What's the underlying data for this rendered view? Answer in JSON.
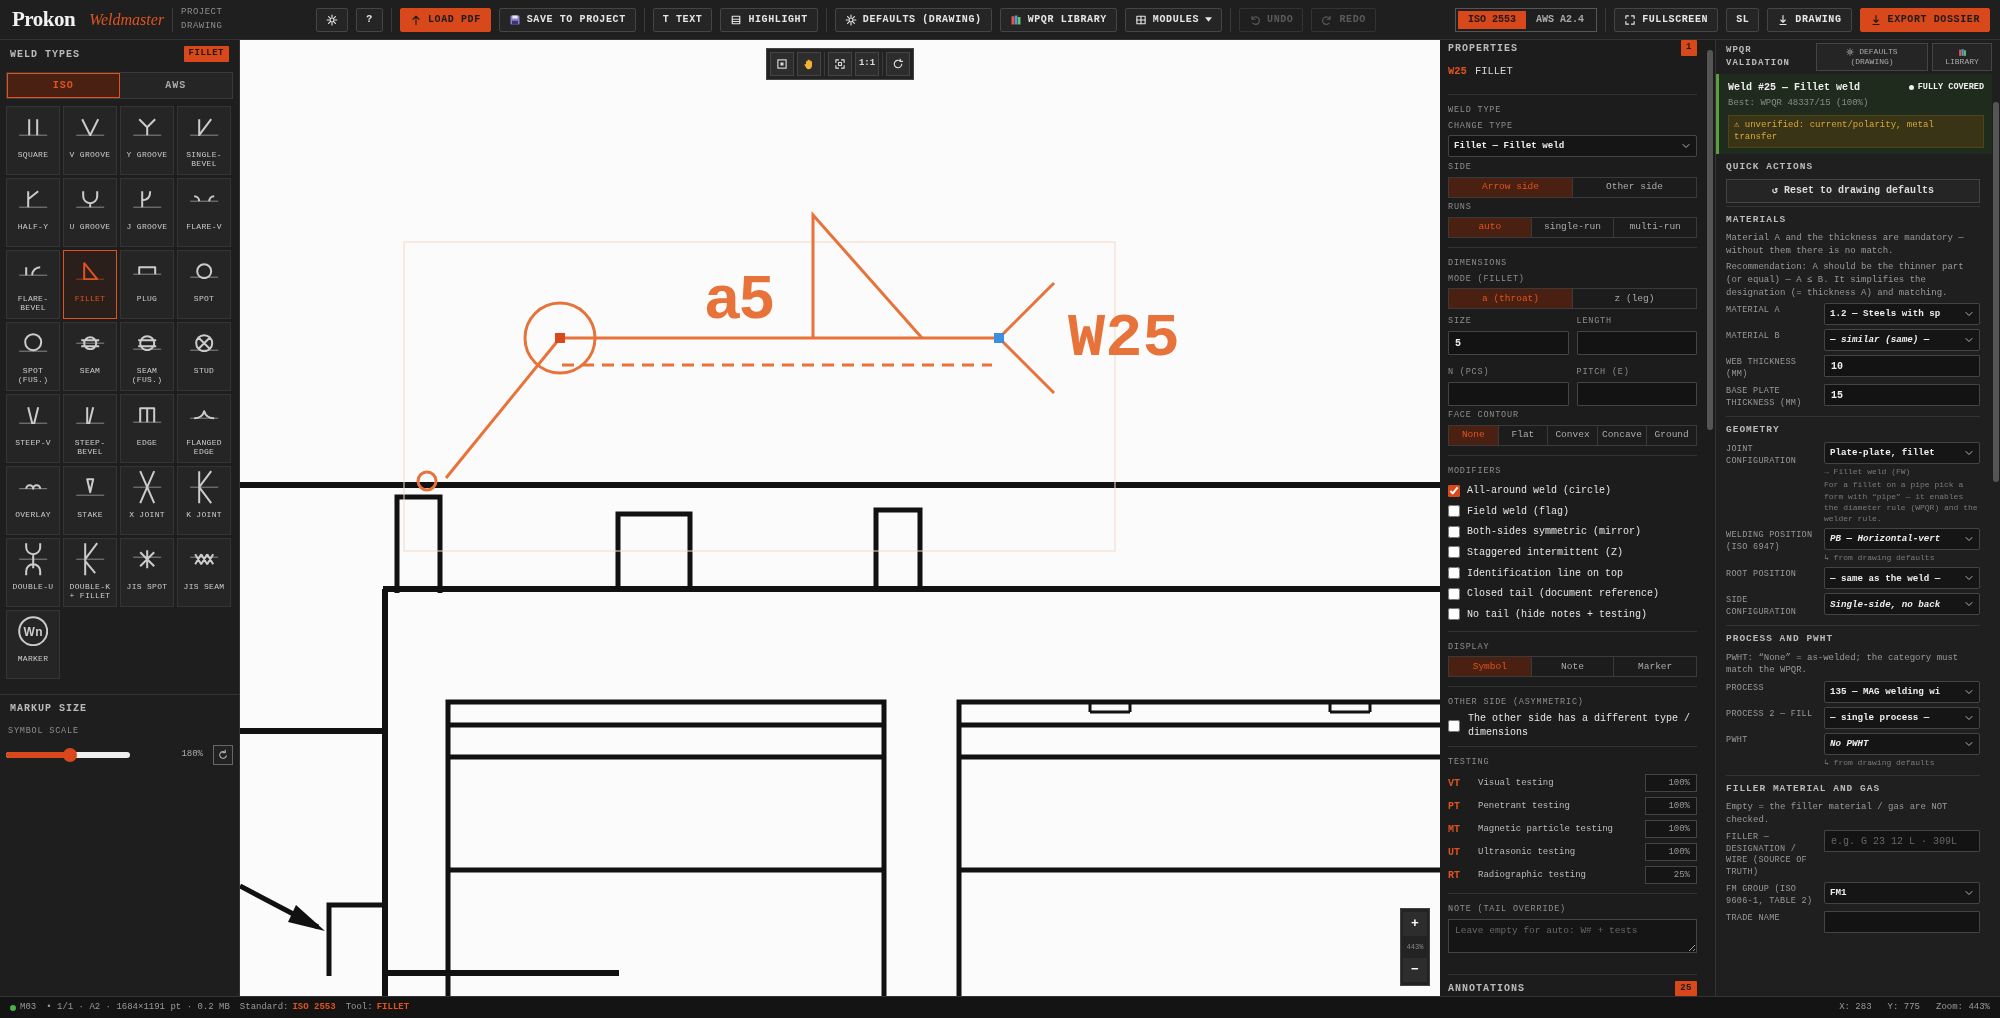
{
  "topbar": {
    "brand": "Prokon",
    "product": "Weldmaster",
    "context": "PROJECT DRAWING",
    "left_groups": [
      [
        {
          "kind": "plain",
          "disabled": false
        },
        {
          "label": "?",
          "kind": "plain",
          "disabled": false
        }
      ],
      [
        {
          "label": "LOAD PDF",
          "kind": "primary",
          "disabled": false
        },
        {
          "label": "SAVE TO PROJECT",
          "kind": "plain",
          "disabled": false
        }
      ],
      [
        {
          "label": "T TEXT",
          "kind": "plain",
          "disabled": false
        },
        {
          "label": "HIGHLIGHT",
          "kind": "plain",
          "disabled": false
        }
      ],
      [
        {
          "label": "DEFAULTS (DRAWING)",
          "kind": "plain",
          "disabled": false
        },
        {
          "label": "WPQR LIBRARY",
          "kind": "plain",
          "disabled": false
        },
        {
          "label": "MODULES",
          "kind": "menu",
          "disabled": false
        }
      ],
      [
        {
          "label": "UNDO",
          "kind": "plain",
          "disabled": true
        },
        {
          "label": "REDO",
          "kind": "plain",
          "disabled": true
        }
      ]
    ],
    "standards": [
      {
        "label": "ISO 2553",
        "selected": true
      },
      {
        "label": "AWS A2.4",
        "selected": false
      }
    ],
    "right_group": [
      {
        "label": "FULLSCREEN",
        "kind": "plain",
        "disabled": false
      },
      {
        "label": "SL",
        "kind": "plain",
        "disabled": false
      },
      {
        "label": "DRAWING",
        "kind": "plain",
        "disabled": false
      },
      {
        "label": "EXPORT DOSSIER",
        "kind": "primary",
        "disabled": false
      }
    ]
  },
  "weld_types": {
    "title": "WELD TYPES",
    "badge": "FILLET",
    "standards": [
      {
        "label": "ISO",
        "selected": true
      },
      {
        "label": "AWS",
        "selected": false
      }
    ],
    "items": [
      {
        "label": "SQUARE",
        "selected": false
      },
      {
        "label": "V GROOVE",
        "selected": false
      },
      {
        "label": "Y GROOVE",
        "selected": false
      },
      {
        "label": "SINGLE-BEVEL",
        "selected": false
      },
      {
        "label": "HALF-Y",
        "selected": false
      },
      {
        "label": "U GROOVE",
        "selected": false
      },
      {
        "label": "J GROOVE",
        "selected": false
      },
      {
        "label": "FLARE-V",
        "selected": false
      },
      {
        "label": "FLARE-BEVEL",
        "selected": false
      },
      {
        "label": "FILLET",
        "selected": true
      },
      {
        "label": "PLUG",
        "selected": false
      },
      {
        "label": "SPOT",
        "selected": false
      },
      {
        "label": "SPOT (FUS.)",
        "selected": false
      },
      {
        "label": "SEAM",
        "selected": false
      },
      {
        "label": "SEAM (FUS.)",
        "selected": false
      },
      {
        "label": "STUD",
        "selected": false
      },
      {
        "label": "STEEP-V",
        "selected": false
      },
      {
        "label": "STEEP-BEVEL",
        "selected": false
      },
      {
        "label": "EDGE",
        "selected": false
      },
      {
        "label": "FLANGED EDGE",
        "selected": false
      },
      {
        "label": "OVERLAY",
        "selected": false
      },
      {
        "label": "STAKE",
        "selected": false
      },
      {
        "label": "X JOINT",
        "selected": false
      },
      {
        "label": "K JOINT",
        "selected": false
      },
      {
        "label": "DOUBLE-U",
        "selected": false
      },
      {
        "label": "DOUBLE-K + FILLET",
        "selected": false
      },
      {
        "label": "JIS SPOT",
        "selected": false
      },
      {
        "label": "JIS SEAM",
        "selected": false
      },
      {
        "label": "MARKER",
        "selected": false,
        "glyph": "Wn"
      }
    ]
  },
  "markup_size": {
    "title": "MARKUP SIZE",
    "slider_label": "SYMBOL SCALE",
    "level": 0.52,
    "reading": "180%"
  },
  "canvas": {
    "scale_button": "1:1",
    "weld_symbol": {
      "size": "a5",
      "label": "W25"
    },
    "zoom": {
      "zoom_in": "+",
      "level": "443%",
      "zoom_out": "−"
    }
  },
  "properties": {
    "title": "PROPERTIES",
    "count": "1",
    "weld_id": "W25",
    "weld_type": "FILLET",
    "weld_type_section": {
      "title": "WELD TYPE",
      "change_label": "CHANGE TYPE",
      "value": "Fillet — Fillet weld"
    },
    "side": {
      "label": "SIDE",
      "options": [
        {
          "label": "Arrow side",
          "selected": true
        },
        {
          "label": "Other side",
          "selected": false
        }
      ]
    },
    "runs": {
      "label": "RUNS",
      "options": [
        {
          "label": "auto",
          "selected": true
        },
        {
          "label": "single-run",
          "selected": false
        },
        {
          "label": "multi-run",
          "selected": false
        }
      ]
    },
    "dimensions": {
      "title": "DIMENSIONS",
      "mode_label": "MODE (FILLET)",
      "modes": [
        {
          "label": "a (throat)",
          "selected": true
        },
        {
          "label": "z (leg)",
          "selected": false
        }
      ],
      "fields": [
        {
          "label": "SIZE",
          "value": "5"
        },
        {
          "label": "LENGTH"
        },
        {
          "label": "N (PCS)"
        },
        {
          "label": "PITCH (E)"
        }
      ]
    },
    "face_contour": {
      "label": "FACE CONTOUR",
      "options": [
        {
          "label": "None",
          "selected": true
        },
        {
          "label": "Flat",
          "selected": false
        },
        {
          "label": "Convex",
          "selected": false
        },
        {
          "label": "Concave",
          "selected": false
        },
        {
          "label": "Ground",
          "selected": false
        }
      ]
    },
    "modifiers": {
      "title": "MODIFIERS",
      "items": [
        {
          "label": "All-around weld (circle)",
          "checked": true
        },
        {
          "label": "Field weld (flag)",
          "checked": false
        },
        {
          "label": "Both-sides symmetric (mirror)",
          "checked": false
        },
        {
          "label": "Staggered intermittent (Z)",
          "checked": false
        },
        {
          "label": "Identification line on top",
          "checked": false
        },
        {
          "label": "Closed tail (document reference)",
          "checked": false
        },
        {
          "label": "No tail (hide notes + testing)",
          "checked": false
        }
      ]
    },
    "display": {
      "label": "DISPLAY",
      "options": [
        {
          "label": "Symbol",
          "selected": true
        },
        {
          "label": "Note",
          "selected": false
        },
        {
          "label": "Marker",
          "selected": false
        }
      ]
    },
    "other_side": {
      "title": "OTHER SIDE (ASYMMETRIC)",
      "label": "The other side has a different type / dimensions",
      "checked": false
    },
    "testing": {
      "title": "TESTING",
      "rows": [
        {
          "code": "VT",
          "name": "Visual testing",
          "value": "100%"
        },
        {
          "code": "PT",
          "name": "Penetrant testing",
          "value": "100%"
        },
        {
          "code": "MT",
          "name": "Magnetic particle testing",
          "value": "100%"
        },
        {
          "code": "UT",
          "name": "Ultrasonic testing",
          "value": "100%"
        },
        {
          "code": "RT",
          "name": "Radiographic testing",
          "value": "25%"
        }
      ]
    },
    "note": {
      "title": "NOTE (TAIL OVERRIDE)",
      "placeholder": "Leave empty for auto: W# + tests"
    },
    "annotations": {
      "title": "ANNOTATIONS",
      "count": "25"
    }
  },
  "wpqr": {
    "title": "WPQR VALIDATION",
    "buttons": [
      {
        "label": "DEFAULTS (DRAWING)"
      },
      {
        "label": "LIBRARY"
      }
    ],
    "result": {
      "title": "Weld #25 — Fillet weld",
      "status": "FULLY COVERED",
      "best": "Best: WPQR 48337/15 (100%)",
      "warning": "⚠ unverified: current/polarity, metal transfer"
    },
    "quick_actions": {
      "title": "QUICK ACTIONS",
      "button": "↺ Reset to drawing defaults"
    },
    "sections": [
      {
        "title": "MATERIALS",
        "paragraphs": [
          "Material A and the thickness are mandatory — without them there is no match.",
          "Recommendation: A should be the thinner part (or equal) — A ≤ B. It simplifies the designation (= thickness A) and matching."
        ],
        "fields": [
          {
            "label": "MATERIAL A",
            "kind": "select",
            "value": "1.2 — Steels with sp",
            "inherited": false
          },
          {
            "label": "MATERIAL B",
            "kind": "select",
            "value": "— similar (same) —",
            "inherited": true
          },
          {
            "label": "WEB THICKNESS (MM)",
            "kind": "input",
            "value": "10"
          },
          {
            "label": "BASE PLATE THICKNESS (MM)",
            "kind": "input",
            "value": "15"
          }
        ]
      },
      {
        "title": "GEOMETRY",
        "fields": [
          {
            "label": "JOINT CONFIGURATION",
            "kind": "select",
            "value": "Plate-plate, fillet",
            "inherited": false,
            "notes": [
              "→ Fillet weld (FW)",
              "For a fillet on a pipe pick a form with “pipe” — it enables the diameter rule (WPQR) and the welder rule."
            ]
          },
          {
            "label": "WELDING POSITION (ISO 6947)",
            "kind": "select",
            "value": "PB — Horizontal-vert",
            "inherited": true,
            "notes": [
              "↳ from drawing defaults"
            ]
          },
          {
            "label": "ROOT POSITION",
            "kind": "select",
            "value": "— same as the weld —",
            "inherited": false
          },
          {
            "label": "SIDE CONFIGURATION",
            "kind": "select",
            "value": "Single-side, no back",
            "inherited": true
          }
        ]
      },
      {
        "title": "PROCESS AND PWHT",
        "paragraphs": [
          "PWHT: “None” = as-welded; the category must match the WPQR."
        ],
        "fields": [
          {
            "label": "PROCESS",
            "kind": "select",
            "value": "135 — MAG welding wi",
            "inherited": false
          },
          {
            "label": "PROCESS 2 — FILL",
            "kind": "select",
            "value": "— single process —",
            "inherited": false
          },
          {
            "label": "PWHT",
            "kind": "select",
            "value": "No PWHT",
            "inherited": true,
            "notes": [
              "↳ from drawing defaults"
            ]
          }
        ]
      },
      {
        "title": "FILLER MATERIAL AND GAS",
        "paragraphs": [
          "Empty = the filler material / gas are NOT checked."
        ],
        "fields": [
          {
            "label": "FILLER — DESIGNATION / WIRE (SOURCE OF TRUTH)",
            "kind": "input",
            "placeholder": "e.g. G 23 12 L · 309L"
          },
          {
            "label": "FM GROUP (ISO 9606-1, TABLE 2)",
            "kind": "select",
            "value": "FM1",
            "inherited": false
          },
          {
            "label": "TRADE NAME",
            "kind": "input"
          }
        ]
      }
    ]
  },
  "status_bar": {
    "file": "M03",
    "info": "• 1/1 · A2 · 1684×1191 pt · 0.2 MB",
    "standard_label": "Standard:",
    "standard": "ISO 2553",
    "tool_label": "Tool:",
    "tool": "FILLET",
    "x": "X: 283",
    "y": "Y: 775",
    "zoom": "Zoom: 443%"
  }
}
